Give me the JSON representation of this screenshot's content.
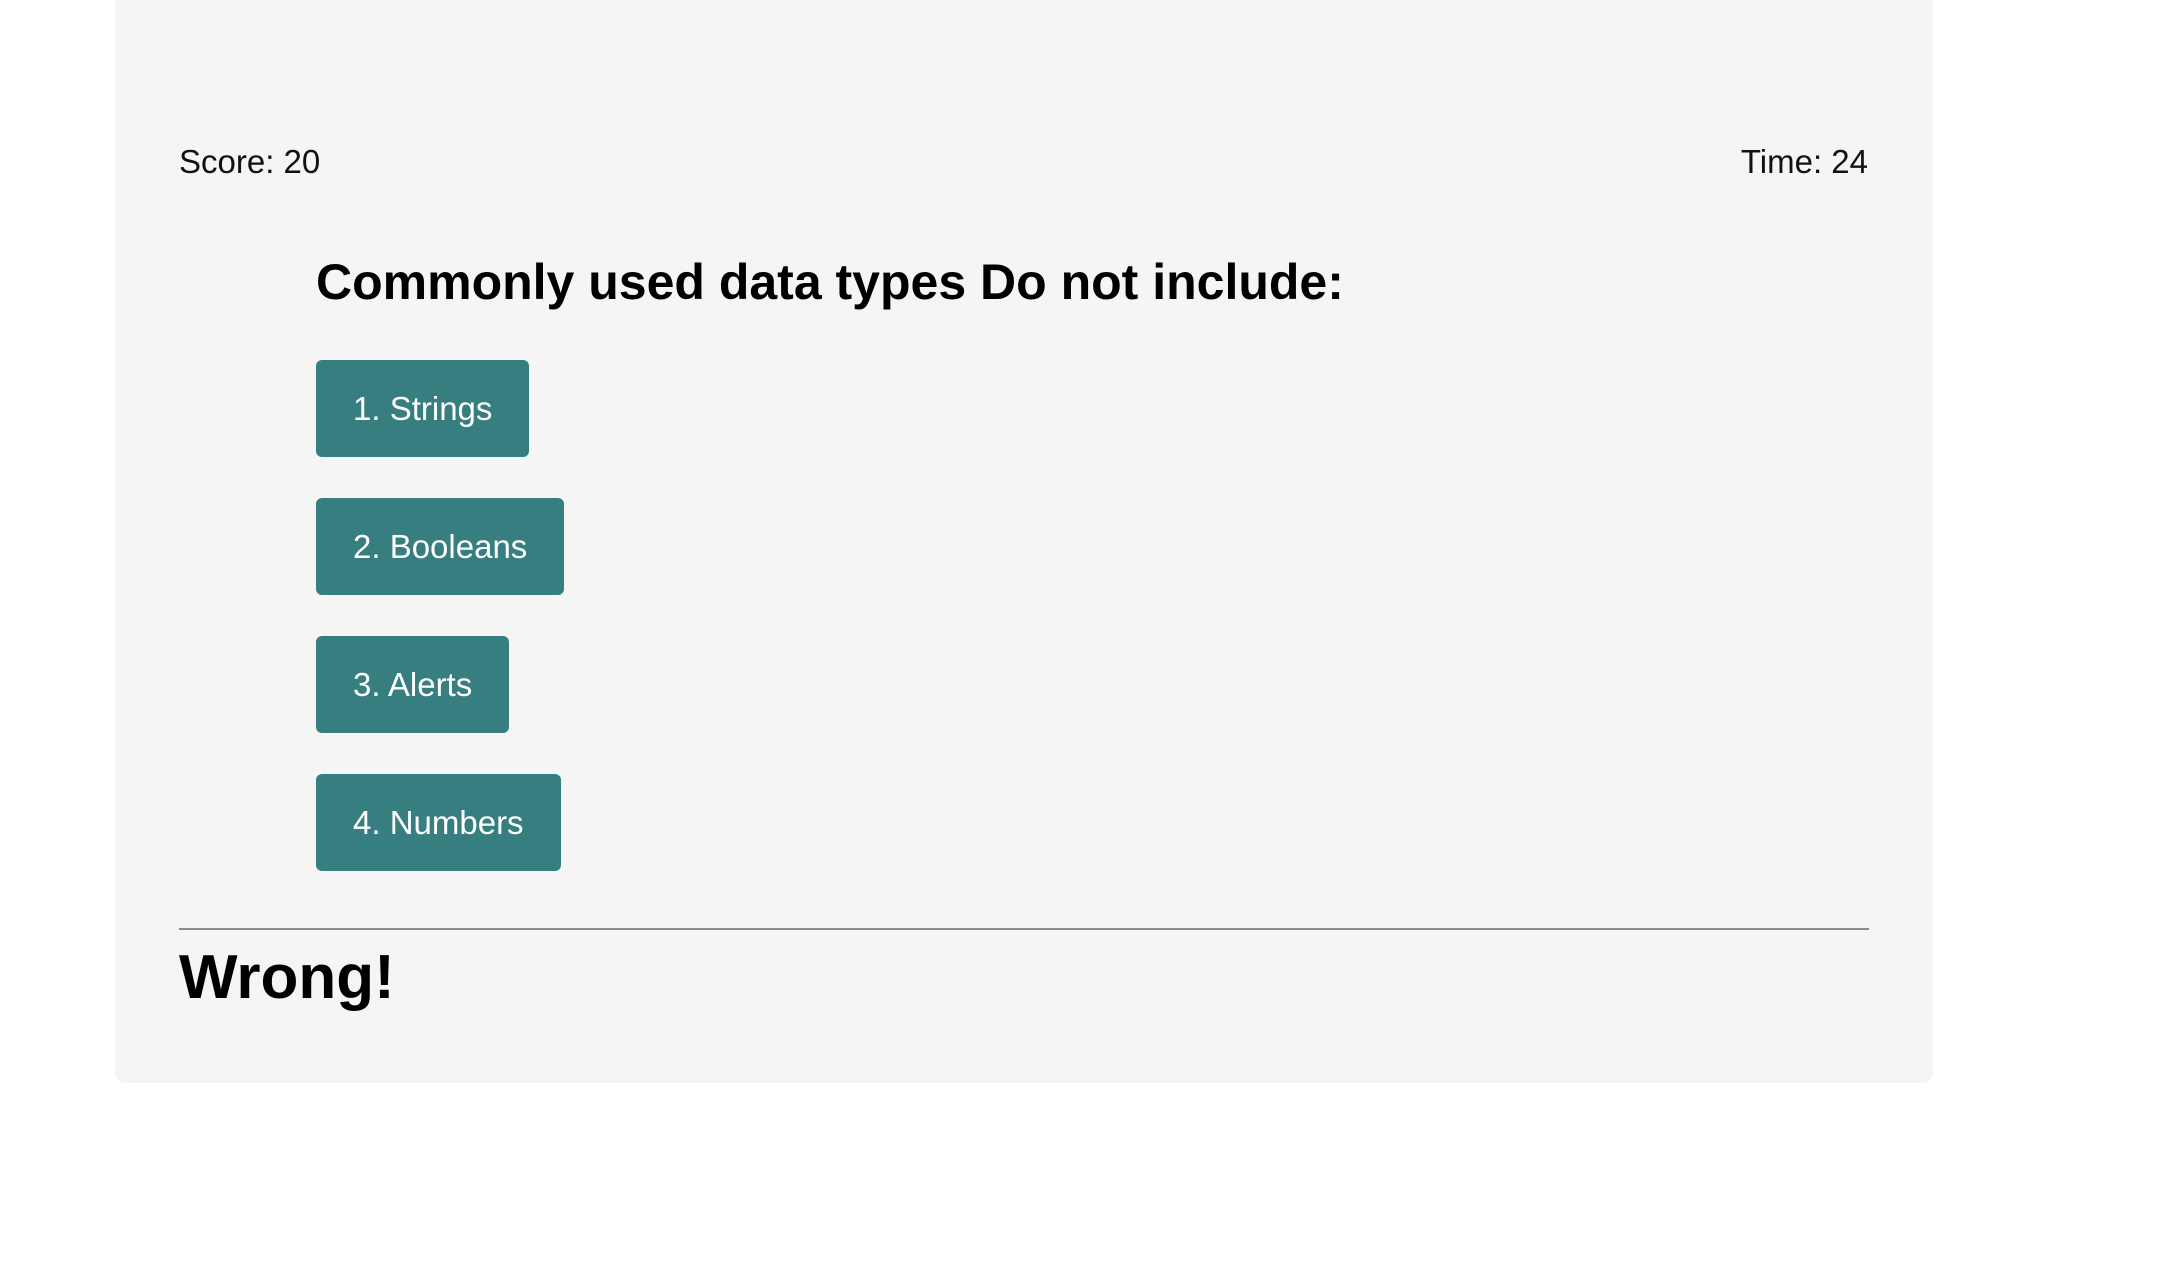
{
  "header": {
    "score_text": "Score: 20",
    "time_text": "Time: 24"
  },
  "quiz": {
    "question": "Commonly used data types Do not include:",
    "choices": [
      {
        "label": "1. Strings"
      },
      {
        "label": "2. Booleans"
      },
      {
        "label": "3. Alerts"
      },
      {
        "label": "4. Numbers"
      }
    ],
    "feedback": "Wrong!"
  },
  "colors": {
    "card_background": "#f5f5f5",
    "button_background": "#377e80",
    "button_text": "#ffffff",
    "divider": "#8c8c8c"
  }
}
